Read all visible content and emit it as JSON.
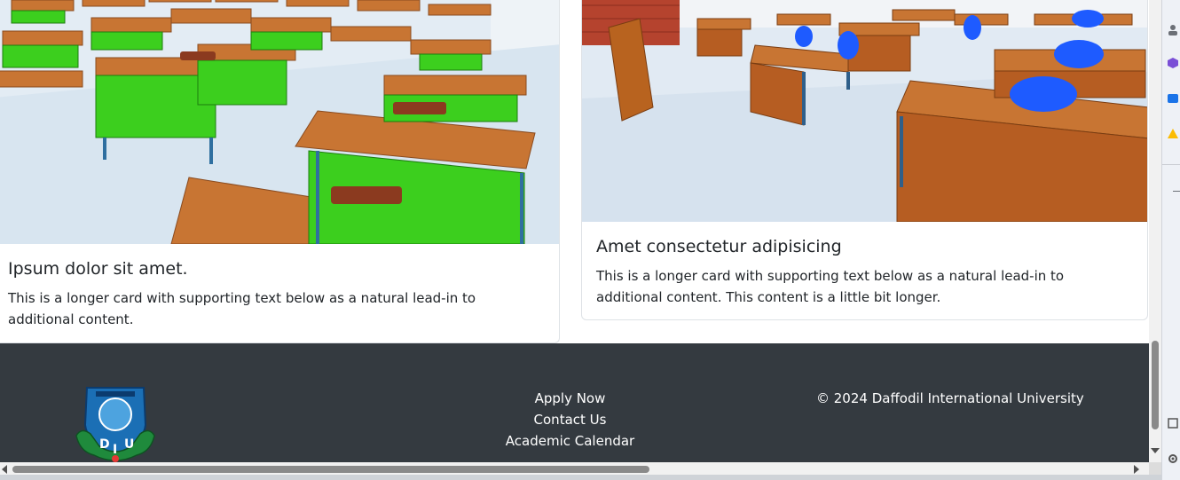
{
  "cards": [
    {
      "title": "Ipsum dolor sit amet.",
      "text": "This is a longer card with supporting text below as a natural lead-in to additional content."
    },
    {
      "title": "Amet consectetur adipisicing",
      "text": "This is a longer card with supporting text below as a natural lead-in to additional content. This content is a little bit longer."
    }
  ],
  "footer": {
    "links": [
      "Apply Now",
      "Contact Us",
      "Academic Calendar"
    ],
    "copyright": "© 2024 Daffodil International University",
    "logo_letters": [
      "D",
      "I",
      "U"
    ]
  },
  "colors": {
    "footer_bg": "#343a40",
    "desk_wood": "#c87533",
    "desk_green": "#3ccf1e",
    "chair_blue": "#1e5bff",
    "floor": "#dfe9f2",
    "brick": "#b5432e"
  }
}
